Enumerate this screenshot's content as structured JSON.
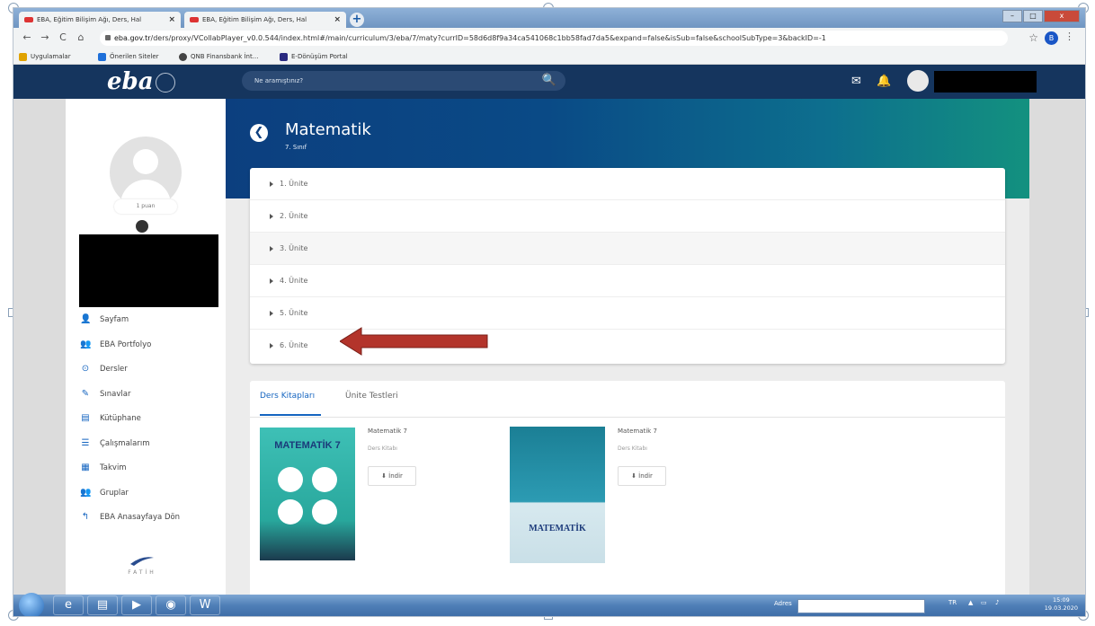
{
  "browser": {
    "tabs": [
      {
        "title": "EBA, Eğitim Bilişim Ağı, Ders, Hal"
      },
      {
        "title": "EBA, Eğitim Bilişim Ağı, Ders, Hal"
      }
    ],
    "new_tab": "+",
    "tab_close": "×",
    "url_domain": "eba.gov.tr",
    "url_path": "/ders/proxy/VCollabPlayer_v0.0.544/index.html#/main/curriculum/3/eba/7/maty?currID=58d6d8f9a34ca541068c1bb58fad7da5&expand=false&isSub=false&schoolSubType=3&backID=-1",
    "star": "☆",
    "profile_initial": "B",
    "menu": "⋮",
    "nav": {
      "back": "←",
      "forward": "→",
      "reload": "C",
      "home": "⌂"
    },
    "bookmarks": [
      {
        "label": "Uygulamalar",
        "color": "#e0a200"
      },
      {
        "label": "Önerilen Siteler",
        "color": "#1e6fd9"
      },
      {
        "label": "QNB Finansbank İnt...",
        "color": "#444"
      },
      {
        "label": "E-Dönüşüm Portal",
        "color": "#2a2a80"
      }
    ]
  },
  "eba": {
    "logo": "eba",
    "search_placeholder": "Ne aramıştınız?",
    "search_icon": "🔍",
    "mail_icon": "✉",
    "bell_icon": "🔔"
  },
  "sidebar": {
    "points": "1 puan",
    "menu": [
      {
        "icon": "👤",
        "label": "Sayfam"
      },
      {
        "icon": "👥",
        "label": "EBA Portfolyo"
      },
      {
        "icon": "⊙",
        "label": "Dersler"
      },
      {
        "icon": "✎",
        "label": "Sınavlar"
      },
      {
        "icon": "▤",
        "label": "Kütüphane"
      },
      {
        "icon": "☰",
        "label": "Çalışmalarım"
      },
      {
        "icon": "▦",
        "label": "Takvim"
      },
      {
        "icon": "👥",
        "label": "Gruplar"
      },
      {
        "icon": "↰",
        "label": "EBA Anasayfaya Dön"
      }
    ],
    "footer_logo": "FATİH"
  },
  "course": {
    "back": "❮",
    "title": "Matematik",
    "grade": "7. Sınıf",
    "units": [
      "1. Ünite",
      "2. Ünite",
      "3. Ünite",
      "4. Ünite",
      "5. Ünite",
      "6. Ünite"
    ]
  },
  "books_panel": {
    "tabs": [
      "Ders Kitapları",
      "Ünite Testleri"
    ],
    "books": [
      {
        "title": "Matematik 7",
        "type": "Ders Kitabı",
        "download": "İndir",
        "cover_text": "MATEMATİK 7"
      },
      {
        "title": "Matematik 7",
        "type": "Ders Kitabı",
        "download": "İndir",
        "cover_text": "MATEMATİK"
      }
    ]
  },
  "taskbar": {
    "address_label": "Adres",
    "lang": "TR",
    "time": "15:09",
    "date": "19.03.2020"
  }
}
